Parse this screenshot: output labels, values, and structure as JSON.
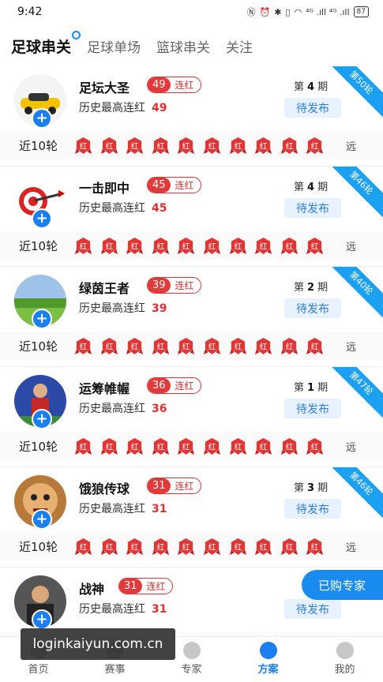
{
  "status_bar": {
    "time": "9:42",
    "signal_text": "⁴ᴳ .ıll ⁴ᴳ .ıll",
    "battery": "87"
  },
  "tabs": [
    {
      "label": "足球串关",
      "active": true
    },
    {
      "label": "足球单场",
      "active": false
    },
    {
      "label": "篮球串关",
      "active": false
    },
    {
      "label": "关注",
      "active": false
    }
  ],
  "common": {
    "streak_suffix": "连红",
    "history_prefix": "历史最高连红",
    "period_prefix": "第",
    "period_suffix": "期",
    "pending_label": "待发布",
    "recent_label": "近10轮",
    "far_label": "远",
    "badge_char": "红",
    "plus": "+"
  },
  "experts": [
    {
      "name": "足坛大圣",
      "streak": "49",
      "history": "49",
      "period": "4",
      "ribbon": "第50轮",
      "avatar": "car-avatar"
    },
    {
      "name": "一击即中",
      "streak": "45",
      "history": "45",
      "period": "4",
      "ribbon": "第46轮",
      "avatar": "dart-avatar"
    },
    {
      "name": "绿茵王者",
      "streak": "39",
      "history": "39",
      "period": "2",
      "ribbon": "第40轮",
      "avatar": "field-avatar"
    },
    {
      "name": "运筹帷幄",
      "streak": "36",
      "history": "36",
      "period": "1",
      "ribbon": "第47轮",
      "avatar": "player-avatar"
    },
    {
      "name": "饿狼传球",
      "streak": "31",
      "history": "31",
      "period": "3",
      "ribbon": "第46轮",
      "avatar": "face-avatar"
    },
    {
      "name": "战神",
      "streak": "31",
      "history": "31",
      "period": "",
      "ribbon": "",
      "avatar": "man-avatar"
    }
  ],
  "float_button": "已购专家",
  "bottom_nav": [
    {
      "label": "首页",
      "icon": "home-icon",
      "active": false
    },
    {
      "label": "赛事",
      "icon": "trophy-icon",
      "active": false
    },
    {
      "label": "专家",
      "icon": "expert-icon",
      "active": false
    },
    {
      "label": "方案",
      "icon": "plan-icon",
      "active": true
    },
    {
      "label": "我的",
      "icon": "profile-icon",
      "active": false
    }
  ],
  "watermark": "loginkaiyun.com.cn",
  "colors": {
    "accent": "#1a7ff0",
    "red": "#e03030",
    "ribbon": "#1ba0f2"
  }
}
